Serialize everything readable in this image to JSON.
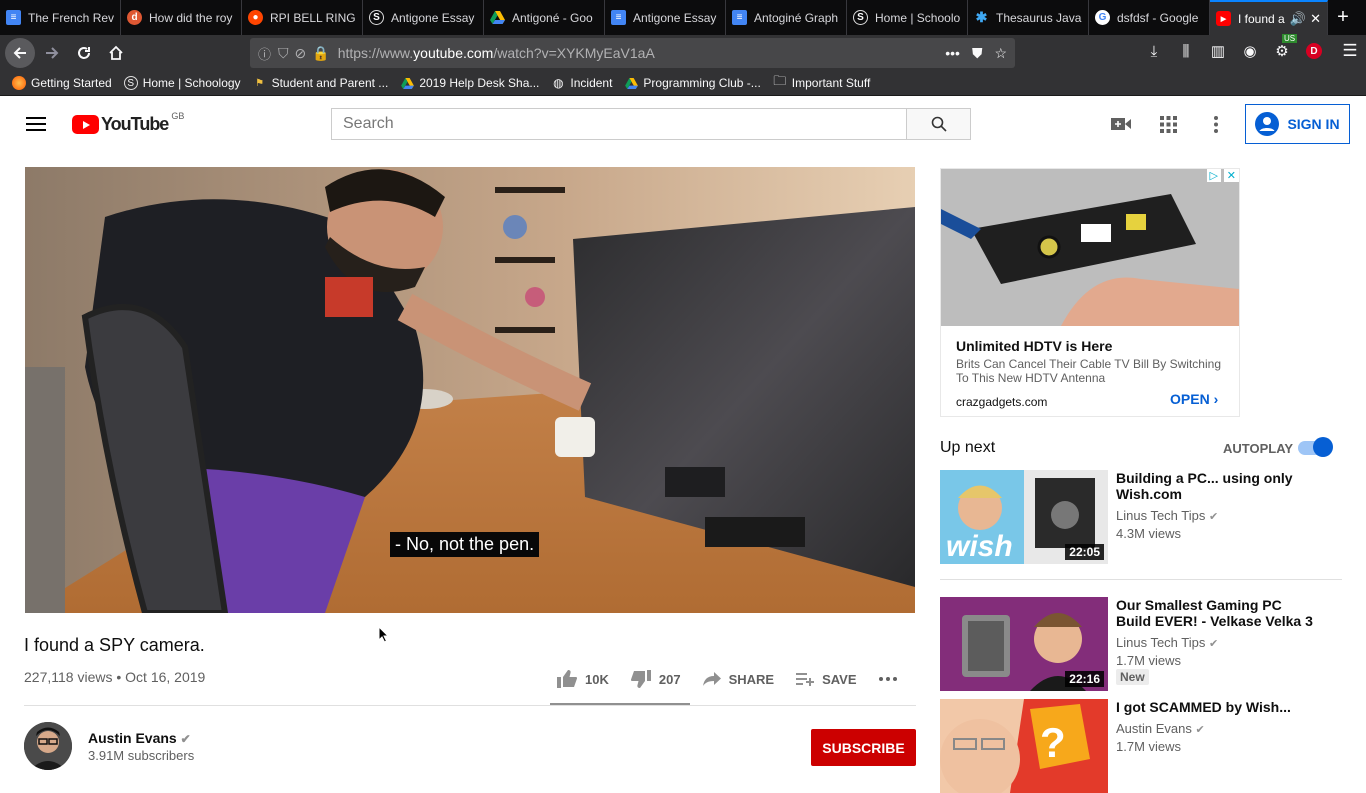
{
  "tabs": [
    {
      "title": "The French Rev",
      "icon": "docs-icon",
      "color": "#4285f4"
    },
    {
      "title": "How did the roy",
      "icon": "duckduckgo-icon",
      "color": "#de5833"
    },
    {
      "title": "RPI BELL RINGE",
      "icon": "reddit-icon",
      "color": "#ff4500"
    },
    {
      "title": "Antigone Essay",
      "icon": "schoology-icon",
      "color": "#2a2a2e"
    },
    {
      "title": "Antigoné - Goo",
      "icon": "drive-icon",
      "color": "#0f9d58"
    },
    {
      "title": "Antigone Essay",
      "icon": "docs-icon",
      "color": "#4285f4"
    },
    {
      "title": "Antoginé Graph",
      "icon": "docs-icon",
      "color": "#4285f4"
    },
    {
      "title": "Home | Schoolo",
      "icon": "schoology-icon",
      "color": "#2a2a2e"
    },
    {
      "title": "Thesaurus Java",
      "icon": "puzzle-icon",
      "color": "#3fa9f5"
    },
    {
      "title": "dsfdsf - Google",
      "icon": "google-icon",
      "color": "#ffffff"
    },
    {
      "title": "I found a",
      "icon": "youtube-icon",
      "color": "#ff0000"
    }
  ],
  "url": {
    "prefix": "https://www.",
    "domain": "youtube.com",
    "path": "/watch?v=XYKMyEaV1aA"
  },
  "bookmarks": [
    {
      "label": "Getting Started",
      "icon": "firefox-icon"
    },
    {
      "label": "Home | Schoology",
      "icon": "schoology-icon"
    },
    {
      "label": "Student and Parent ...",
      "icon": "flag-icon"
    },
    {
      "label": "2019 Help Desk Sha...",
      "icon": "drive-icon"
    },
    {
      "label": "Incident",
      "icon": "globe-icon"
    },
    {
      "label": "Programming Club -...",
      "icon": "drive-icon"
    },
    {
      "label": "Important Stuff",
      "icon": "folder-icon"
    }
  ],
  "extension_badge": "US",
  "profile_letter": "D",
  "yt": {
    "logo_text": "YouTube",
    "region": "GB",
    "search_placeholder": "Search",
    "sign_in": "SIGN IN"
  },
  "video": {
    "caption": "- No, not the pen.",
    "title": "I found a SPY camera.",
    "meta": "227,118 views • Oct 16, 2019",
    "likes": "10K",
    "dislikes": "207",
    "share": "SHARE",
    "save": "SAVE",
    "like_ratio": 0.98
  },
  "channel": {
    "name": "Austin Evans",
    "subscribers": "3.91M subscribers",
    "subscribe": "SUBSCRIBE"
  },
  "ad": {
    "title": "Unlimited HDTV is Here",
    "description": "Brits Can Cancel Their Cable TV Bill By Switching To This New HDTV Antenna",
    "domain": "crazgadgets.com",
    "cta": "OPEN"
  },
  "sidebar": {
    "up_next": "Up next",
    "autoplay": "AUTOPLAY",
    "autoplay_on": true,
    "recs": [
      {
        "title": "Building a PC... using only Wish.com",
        "channel": "Linus Tech Tips",
        "views": "4.3M views",
        "duration": "22:05"
      },
      {
        "title": "Our Smallest Gaming PC Build EVER! - Velkase Velka 3",
        "channel": "Linus Tech Tips",
        "views": "1.7M views",
        "duration": "22:16",
        "badge": "New"
      },
      {
        "title": "I got SCAMMED by Wish...",
        "channel": "Austin Evans",
        "views": "1.7M views"
      }
    ]
  }
}
